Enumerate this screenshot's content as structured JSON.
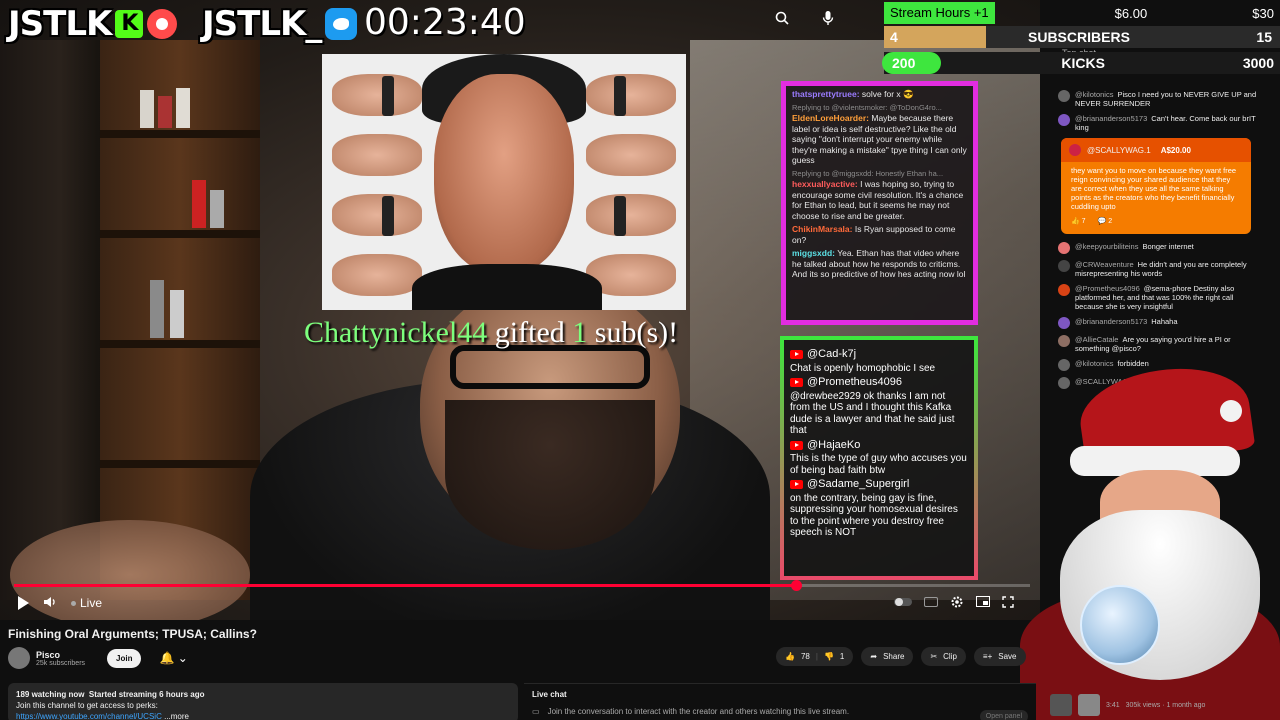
{
  "overlay": {
    "brand1": "JSTLK",
    "brand1_badge": "K",
    "brand2": "JSTLK_",
    "timer": "00:23:40",
    "gift_user": "Chattynickel44",
    "gift_word": "gifted",
    "gift_count": "1",
    "gift_suffix": "sub(s)!"
  },
  "goals": {
    "stream_hours_label": "Stream Hours",
    "stream_hours_inc": "+1",
    "money_now": "$6.00",
    "money_target": "$30",
    "subscribers_current": "4",
    "subscribers_label": "SUBSCRIBERS",
    "subscribers_target": "15",
    "kicks_current": "200",
    "kicks_label": "KICKS",
    "kicks_target": "3000",
    "progress_fraction": 0.26,
    "colors": {
      "green": "#3ee63e",
      "gold": "#d4a55c"
    }
  },
  "overlay_chat1": [
    {
      "user": "thatsprettytruee:",
      "text": "solve for x"
    },
    {
      "reply": "Replying to @violentsmoker: @ToDonG4ro...",
      "user": "EldenLoreHoarder:",
      "text": "Maybe because there label or idea is self destructive? Like the old saying \"don't interrupt your enemy while they're making a mistake\" tpye thing I can only guess"
    },
    {
      "reply": "Replying to @miggsxdd: Honestly Ethan ha...",
      "user": "hexxuallyactive:",
      "text": "I was hoping so, trying to encourage some civil resolution. It's a chance for Ethan to lead, but it seems he may not choose to rise and be greater."
    },
    {
      "user": "ChikinMarsala:",
      "text": "Is Ryan supposed to come on?"
    },
    {
      "user": "miggsxdd:",
      "text": "Yea. Ethan has that video where he talked about how he responds to criticms. And its so predictive of how hes acting now lol"
    }
  ],
  "overlay_chat2": [
    {
      "user": "@Cad-k7j",
      "text": "Chat is openly homophobic I see"
    },
    {
      "user": "@Prometheus4096",
      "text": "@drewbee2929 ok thanks I am not from the US and I thought this Kafka dude is a lawyer and that he said just that"
    },
    {
      "user": "@HajaeKo",
      "text": "This is the type of guy who accuses you of being bad faith btw"
    },
    {
      "user": "@Sadame_Supergirl",
      "text": "on the contrary, being gay is fine, suppressing your homosexual desires to the point where you destroy free speech is NOT"
    }
  ],
  "player": {
    "live_label": "Live",
    "progress_fraction": 0.77
  },
  "chat": {
    "header": "Top chat",
    "messages": [
      {
        "user": "@kilotonics",
        "text": "Pisco I need you to NEVER GIVE UP and NEVER SURRENDER"
      },
      {
        "user": "@briananderson5173",
        "text": "Can't hear. Come back our brIT king"
      }
    ],
    "superchat": {
      "user": "@SCALLYWAG.1",
      "amount": "A$20.00",
      "text": "they want you to move on because they want free reign convincing your shared audience that they are correct when they use all the same talking points as the creators who they benefit financially cuddling upto",
      "likes": "7",
      "replies": "2"
    },
    "messages2": [
      {
        "user": "@keepyourbiliteins",
        "text": "Bonger internet"
      },
      {
        "user": "@CRWeaventure",
        "text": "He didn't and you are completely misrepresenting his words"
      },
      {
        "user": "@Prometheus4096",
        "text": "@sema-phore Destiny also platformed her, and that was 100% the right call because she is very insightful"
      },
      {
        "user": "@briananderson5173",
        "text": "Hahaha"
      },
      {
        "user": "@AllieCatale",
        "text": "Are you saying you'd hire a PI or something @pisco?"
      },
      {
        "user": "@kilotonics",
        "text": "forbidden"
      },
      {
        "user": "@SCALLYWAG",
        "text": ""
      }
    ]
  },
  "video_info": {
    "title": "Finishing Oral Arguments; TPUSA; Callins?",
    "channel": "Pisco",
    "subscribers": "25k subscribers",
    "join": "Join",
    "likes": "78",
    "dislikes": "1",
    "share": "Share",
    "clip": "Clip",
    "save": "Save",
    "watching": "189 watching now",
    "started": "Started streaming 6 hours ago",
    "perks": "Join this channel to get access to perks:",
    "link": "https://www.youtube.com/channel/UCSiC",
    "more": "...more"
  },
  "livechat": {
    "title": "Live chat",
    "prompt": "Join the conversation to interact with the creator and others watching this live stream.",
    "open": "Open panel"
  },
  "side_video": {
    "duration": "3:41",
    "meta": "305k views · 1 month ago"
  }
}
